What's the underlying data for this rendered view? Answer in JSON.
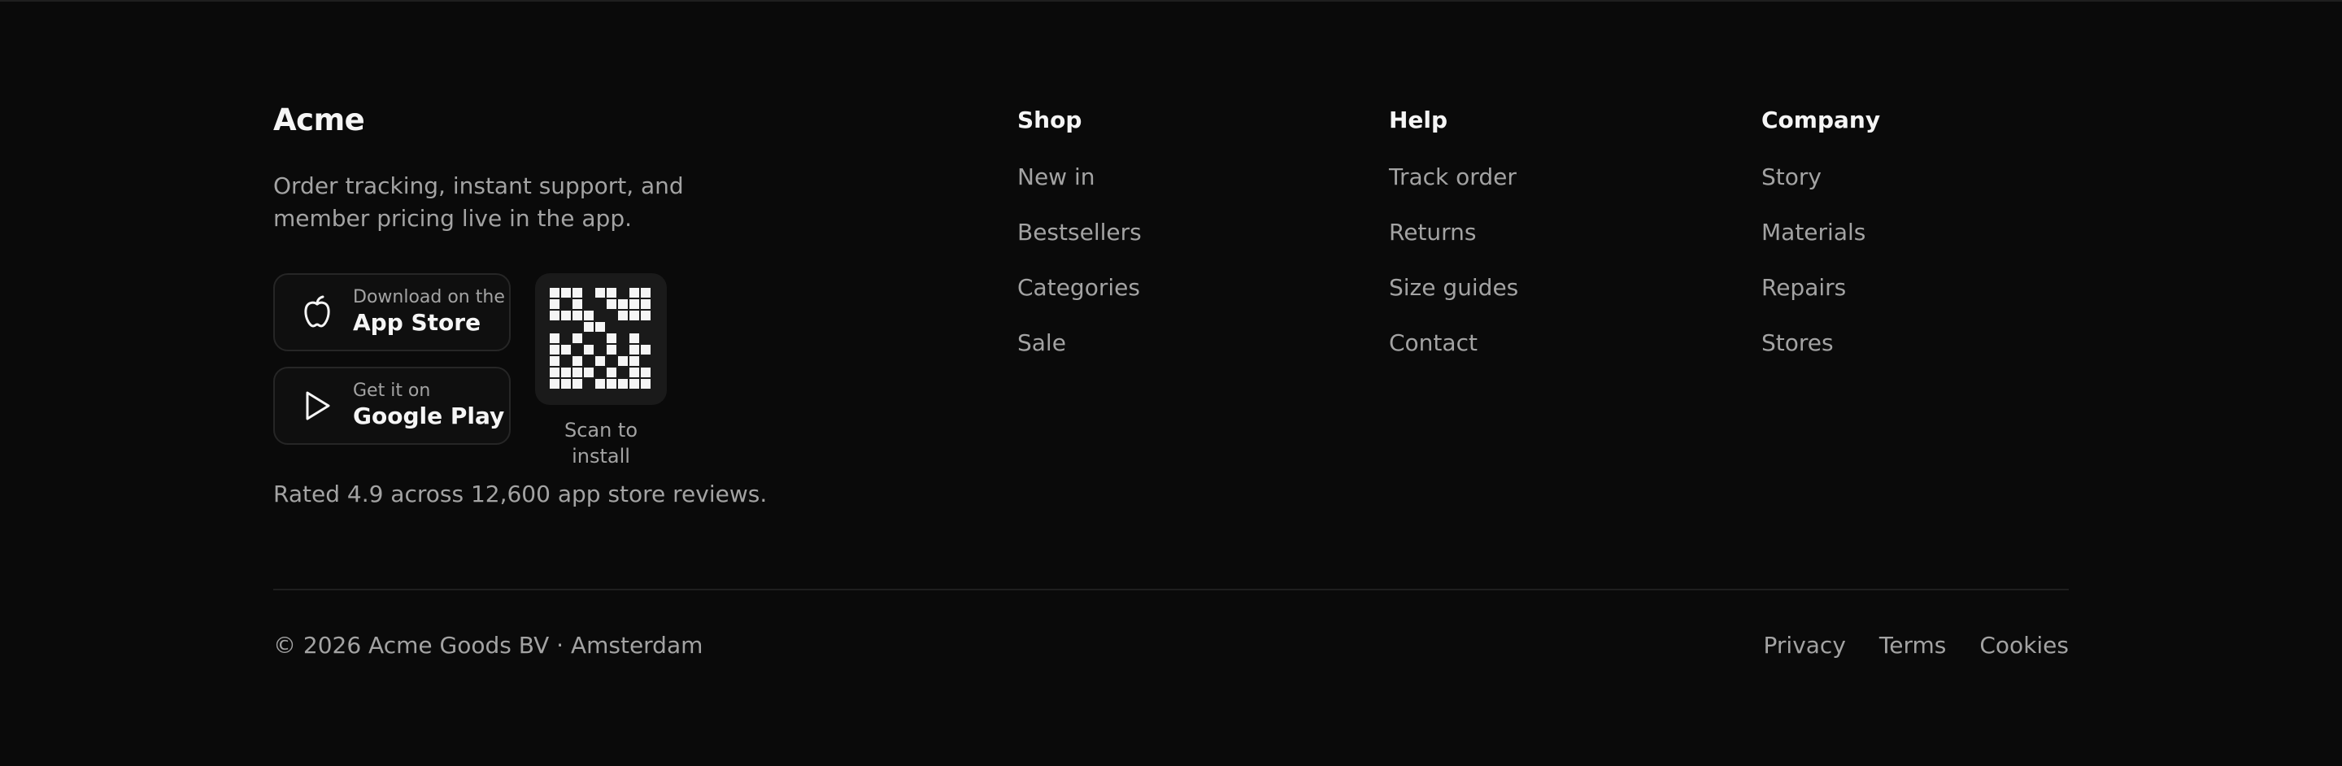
{
  "brand": {
    "name": "Acme",
    "tagline": "Order tracking, instant support, and member pricing live in the app."
  },
  "app_store": {
    "small_label": "Download on the",
    "big_label": "App Store",
    "icon": "apple-icon"
  },
  "google_play": {
    "small_label": "Get it on",
    "big_label": "Google Play",
    "icon": "play-icon"
  },
  "qr": {
    "caption": "Scan to install",
    "pattern": [
      "111011011",
      "101001111",
      "111100111",
      "000110000",
      "101001010",
      "110101011",
      "101010110",
      "111101011",
      "111011111"
    ]
  },
  "rating_text": "Rated 4.9 across 12,600 app store reviews.",
  "columns": [
    {
      "heading": "Shop",
      "links": [
        "New in",
        "Bestsellers",
        "Categories",
        "Sale"
      ]
    },
    {
      "heading": "Help",
      "links": [
        "Track order",
        "Returns",
        "Size guides",
        "Contact"
      ]
    },
    {
      "heading": "Company",
      "links": [
        "Story",
        "Materials",
        "Repairs",
        "Stores"
      ]
    }
  ],
  "bottom": {
    "copyright": "© 2026 Acme Goods BV · Amsterdam",
    "legal_links": [
      "Privacy",
      "Terms",
      "Cookies"
    ]
  },
  "colors": {
    "background": "#0a0a0a",
    "text_primary": "#f5f5f5",
    "text_muted": "#a3a3a3",
    "border": "#262626"
  }
}
